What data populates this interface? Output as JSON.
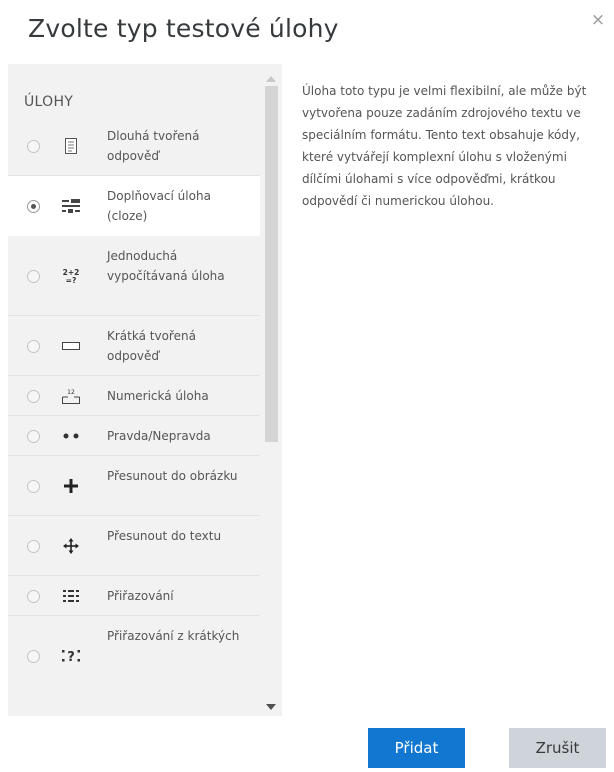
{
  "dialog": {
    "title": "Zvolte typ testové úlohy",
    "close_glyph": "×"
  },
  "list": {
    "heading": "ÚLOHY",
    "selected_index": 1,
    "options": [
      {
        "label": "Dlouhá tvořená odpověď",
        "icon": "essay-icon",
        "selected": false
      },
      {
        "label": "Doplňovací úloha (cloze)",
        "icon": "cloze-icon",
        "selected": true
      },
      {
        "label": "Jednoduchá vypočítávaná úloha",
        "icon": "calculated-icon",
        "selected": false
      },
      {
        "label": "Krátká tvořená odpověď",
        "icon": "short-answer-icon",
        "selected": false
      },
      {
        "label": "Numerická úloha",
        "icon": "numerical-icon",
        "selected": false
      },
      {
        "label": "Pravda/Nepravda",
        "icon": "true-false-icon",
        "selected": false
      },
      {
        "label": "Přesunout do obrázku",
        "icon": "drag-image-icon",
        "selected": false
      },
      {
        "label": "Přesunout do textu",
        "icon": "drag-text-icon",
        "selected": false
      },
      {
        "label": "Přiřazování",
        "icon": "matching-icon",
        "selected": false
      },
      {
        "label": "Přiřazování z krátkých",
        "icon": "random-short-matching-icon",
        "selected": false
      }
    ]
  },
  "description": "Úloha toto typu je velmi flexibilní, ale může být vytvořena pouze zadáním zdrojového textu ve speciálním formátu. Tento text obsahuje kódy, které vytvářejí komplexní úlohu s vloženými dílčími úlohami s více odpověďmi, krátkou odpovědí či numerickou úlohou.",
  "footer": {
    "add_label": "Přidat",
    "cancel_label": "Zrušit"
  },
  "colors": {
    "primary": "#1177d1",
    "secondary": "#ced4da",
    "panel": "#f2f2f2"
  }
}
